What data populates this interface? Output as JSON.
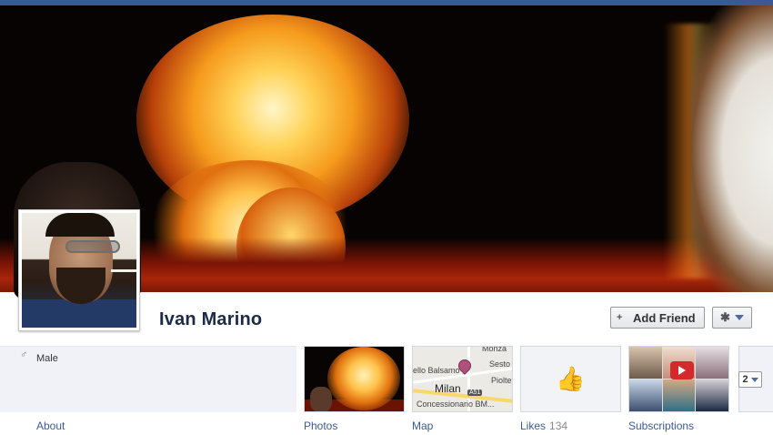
{
  "profile": {
    "name": "Ivan Marino",
    "gender": "Male",
    "gender_icon": "♂"
  },
  "actions": {
    "add_friend_label": "Add Friend",
    "add_friend_icon": "+",
    "gear_icon": "✱",
    "more_count": "2"
  },
  "map": {
    "labels": [
      "Monza",
      "Sesto San",
      "ello Balsamo",
      "Pioltel",
      "Milan",
      "A51",
      "Concessionario BM..."
    ]
  },
  "tabs": [
    {
      "label": "About",
      "count": ""
    },
    {
      "label": "Photos",
      "count": ""
    },
    {
      "label": "Map",
      "count": ""
    },
    {
      "label": "Likes",
      "count": "134"
    },
    {
      "label": "Subscriptions",
      "count": ""
    }
  ],
  "colors": {
    "brand": "#3b5998",
    "name": "#1c2a47"
  }
}
